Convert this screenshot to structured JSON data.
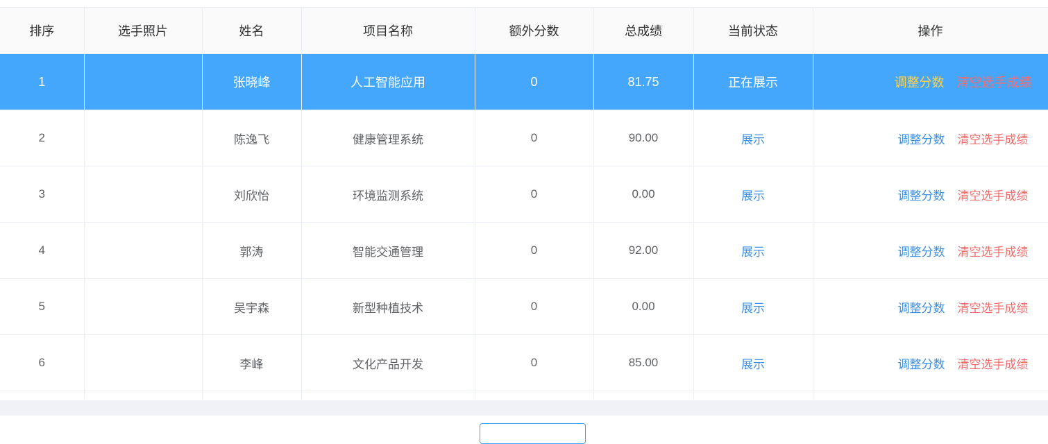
{
  "table": {
    "headers": [
      "排序",
      "选手照片",
      "姓名",
      "项目名称",
      "额外分数",
      "总成绩",
      "当前状态",
      "操作"
    ],
    "action_adjust_label": "调整分数",
    "action_clear_label": "清空选手成绩",
    "rows": [
      {
        "rank": "1",
        "photo": "",
        "name": "张晓峰",
        "project": "人工智能应用",
        "extra": "0",
        "total": "81.75",
        "status": "正在展示",
        "active": true
      },
      {
        "rank": "2",
        "photo": "",
        "name": "陈逸飞",
        "project": "健康管理系统",
        "extra": "0",
        "total": "90.00",
        "status": "展示",
        "active": false
      },
      {
        "rank": "3",
        "photo": "",
        "name": "刘欣怡",
        "project": "环境监测系统",
        "extra": "0",
        "total": "0.00",
        "status": "展示",
        "active": false
      },
      {
        "rank": "4",
        "photo": "",
        "name": "郭涛",
        "project": "智能交通管理",
        "extra": "0",
        "total": "92.00",
        "status": "展示",
        "active": false
      },
      {
        "rank": "5",
        "photo": "",
        "name": "吴宇森",
        "project": "新型种植技术",
        "extra": "0",
        "total": "0.00",
        "status": "展示",
        "active": false
      },
      {
        "rank": "6",
        "photo": "",
        "name": "李峰",
        "project": "文化产品开发",
        "extra": "0",
        "total": "85.00",
        "status": "展示",
        "active": false
      }
    ]
  },
  "colors": {
    "active_row": "#44a7fc",
    "link_blue": "#3d8fe0",
    "link_red": "#f26c6c",
    "active_adjust": "#ffd24a"
  }
}
